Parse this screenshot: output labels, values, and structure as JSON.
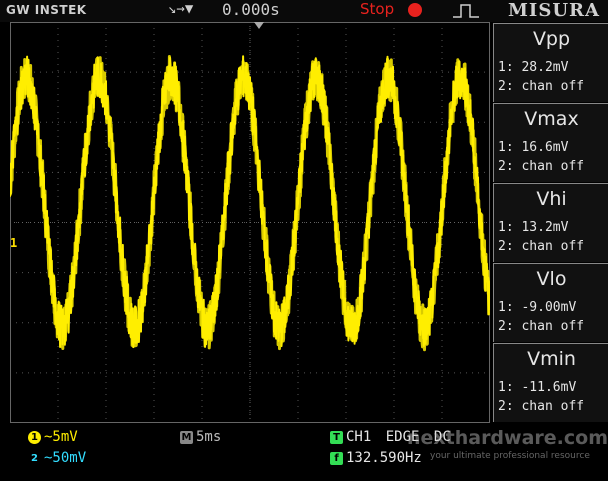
{
  "header": {
    "brand": "GW INSTEK",
    "trigger_arrows": "↘→▼",
    "time_offset": "0.000s",
    "run_state": "Stop",
    "trigger_edge_icon": "rising-edge-icon",
    "menu_title": "MISURA"
  },
  "scope": {
    "ch1_marker": "1",
    "trace_color": "#ffee00",
    "ch1_volts_per_div": 5,
    "time_per_div_ms": 5,
    "frequency_hz": 132.59
  },
  "chart_data": {
    "type": "line",
    "title": "",
    "xlabel": "",
    "ylabel": "",
    "x_unit": "ms",
    "y_unit": "mV",
    "xlim": [
      -25,
      25
    ],
    "ylim": [
      -20,
      20
    ],
    "grid": true,
    "series": [
      {
        "name": "",
        "amplitude_mV": 12.5,
        "offset_mV": 2.0,
        "frequency_hz": 132.59,
        "noise_mV": 2.2,
        "x": [
          -23.3,
          -19.5,
          -15.8,
          -11.9,
          -8.2,
          -4.4,
          -0.6,
          3.2,
          6.9,
          10.6,
          14.5,
          18.3,
          22.1
        ],
        "y": [
          14.5,
          -10.5,
          14.5,
          -10.5,
          14.5,
          -10.5,
          14.5,
          -10.5,
          14.5,
          -10.5,
          14.5,
          -10.5,
          14.5
        ]
      }
    ]
  },
  "measurements": [
    {
      "title": "Vpp",
      "line1": "1: 28.2mV",
      "line2": "2: chan off"
    },
    {
      "title": "Vmax",
      "line1": "1: 16.6mV",
      "line2": "2: chan off"
    },
    {
      "title": "Vhi",
      "line1": "1: 13.2mV",
      "line2": "2: chan off"
    },
    {
      "title": "Vlo",
      "line1": "1: -9.00mV",
      "line2": "2: chan off"
    },
    {
      "title": "Vmin",
      "line1": "1: -11.6mV",
      "line2": "2: chan off"
    }
  ],
  "footer": {
    "ch1_badge": "1",
    "ch1_scale": "~5mV",
    "ch2_badge": "2",
    "ch2_scale": "~50mV",
    "time_badge": "M",
    "time_scale": "5ms",
    "trig_badge": "T",
    "trig_source": "CH1",
    "trig_mode": "EDGE",
    "trig_coupling": "DC",
    "freq_badge": "f",
    "frequency": "132.590Hz",
    "watermark": "nexthardware.com",
    "watermark_sub": "your ultimate professional resource",
    "colors": {
      "ch1": "#ffee00",
      "ch2": "#33ddff",
      "time": "#bbbbbb",
      "trig": "#33dd55"
    }
  }
}
